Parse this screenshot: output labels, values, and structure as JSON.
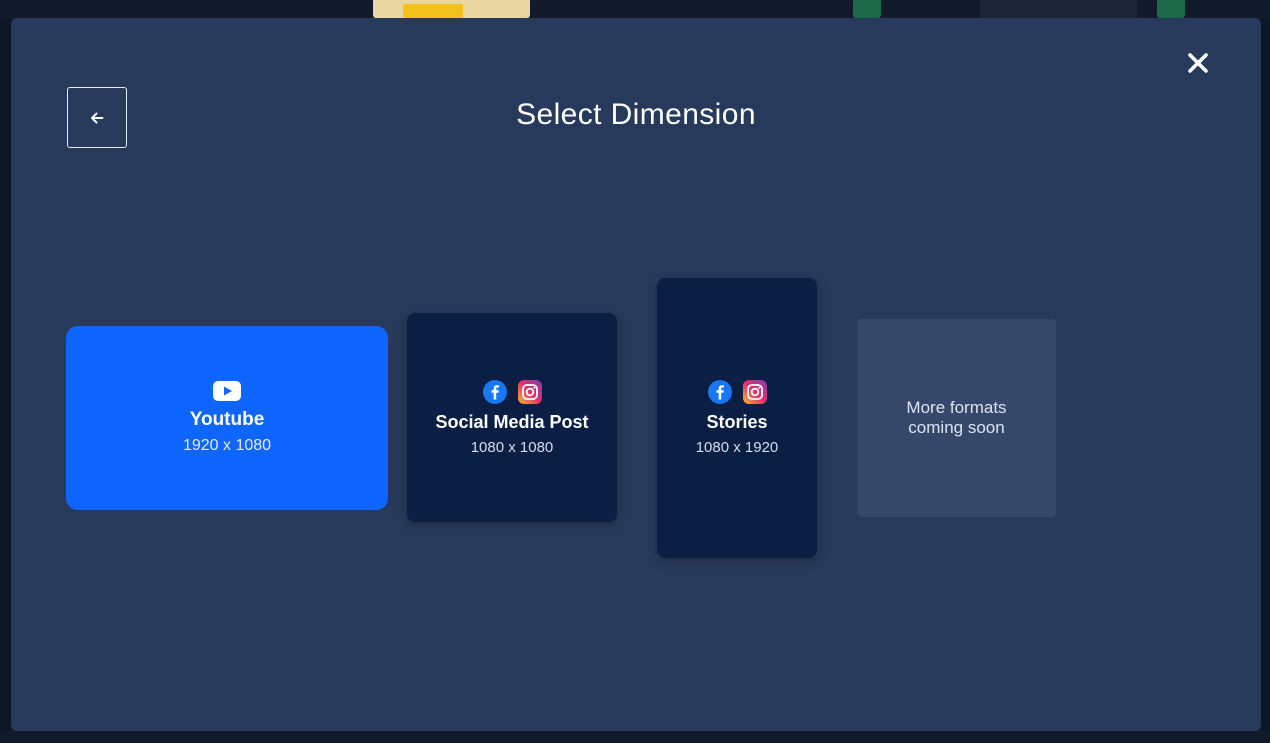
{
  "modal": {
    "title": "Select Dimension",
    "back_icon": "arrow-left-icon",
    "close_icon": "close-icon"
  },
  "formats": [
    {
      "name": "Youtube",
      "dimensions": "1920 x 1080",
      "icons": [
        "youtube-icon"
      ],
      "selected": true,
      "color": "#0f66ff"
    },
    {
      "name": "Social Media Post",
      "dimensions": "1080 x 1080",
      "icons": [
        "facebook-icon",
        "instagram-icon"
      ],
      "selected": false,
      "color": "#0b1f45"
    },
    {
      "name": "Stories",
      "dimensions": "1080 x 1920",
      "icons": [
        "facebook-icon",
        "instagram-icon"
      ],
      "selected": false,
      "color": "#0b1f45"
    }
  ],
  "more_formats": {
    "message": "More formats coming soon"
  },
  "colors": {
    "modal_bg": "#283a5c",
    "accent": "#0f66ff",
    "card_dark": "#0b1f45",
    "placeholder": "#36486a"
  }
}
